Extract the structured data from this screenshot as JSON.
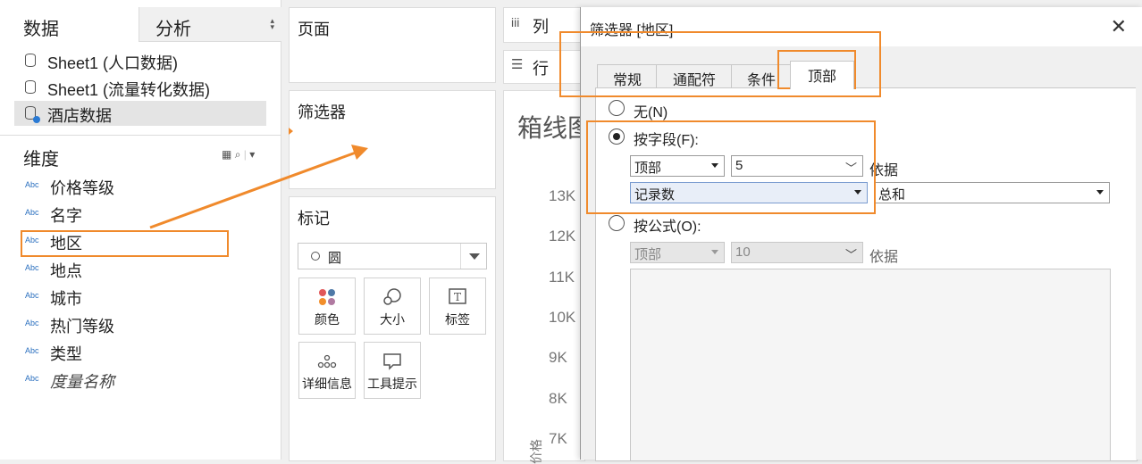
{
  "left": {
    "tabs": [
      "数据",
      "分析"
    ],
    "datasources": [
      {
        "label": "Sheet1 (人口数据)"
      },
      {
        "label": "Sheet1 (流量转化数据)"
      },
      {
        "label": "酒店数据"
      }
    ],
    "dimensions_title": "维度",
    "dim_type": "Abc",
    "dimensions": [
      "价格等级",
      "名字",
      "地区",
      "地点",
      "城市",
      "热门等级",
      "类型",
      "度量名称"
    ]
  },
  "shelves": {
    "pages": "页面",
    "filters": "筛选器",
    "marks": "标记",
    "mark_type": "圆",
    "mark_buttons": [
      "颜色",
      "大小",
      "标签",
      "详细信息",
      "工具提示"
    ]
  },
  "canvas": {
    "columns": "列",
    "rows": "行",
    "title": "箱线图",
    "ticks": [
      "13K",
      "12K",
      "11K",
      "10K",
      "9K",
      "8K",
      "7K"
    ],
    "ylabel": "价格"
  },
  "dialog": {
    "title": "筛选器 [地区]",
    "tabs": [
      "常规",
      "通配符",
      "条件",
      "顶部"
    ],
    "opt_none": "无(N)",
    "opt_field": "按字段(F):",
    "opt_formula": "按公式(O):",
    "field_dir": "顶部",
    "field_count": "5",
    "by_label": "依据",
    "field_name": "记录数",
    "aggregation": "总和",
    "formula_dir": "顶部",
    "formula_count": "10",
    "formula_by": "依据"
  },
  "colors": {
    "accent": "#f08a2c",
    "arrow": "#f08a2c",
    "link": "#2a6fbf"
  }
}
